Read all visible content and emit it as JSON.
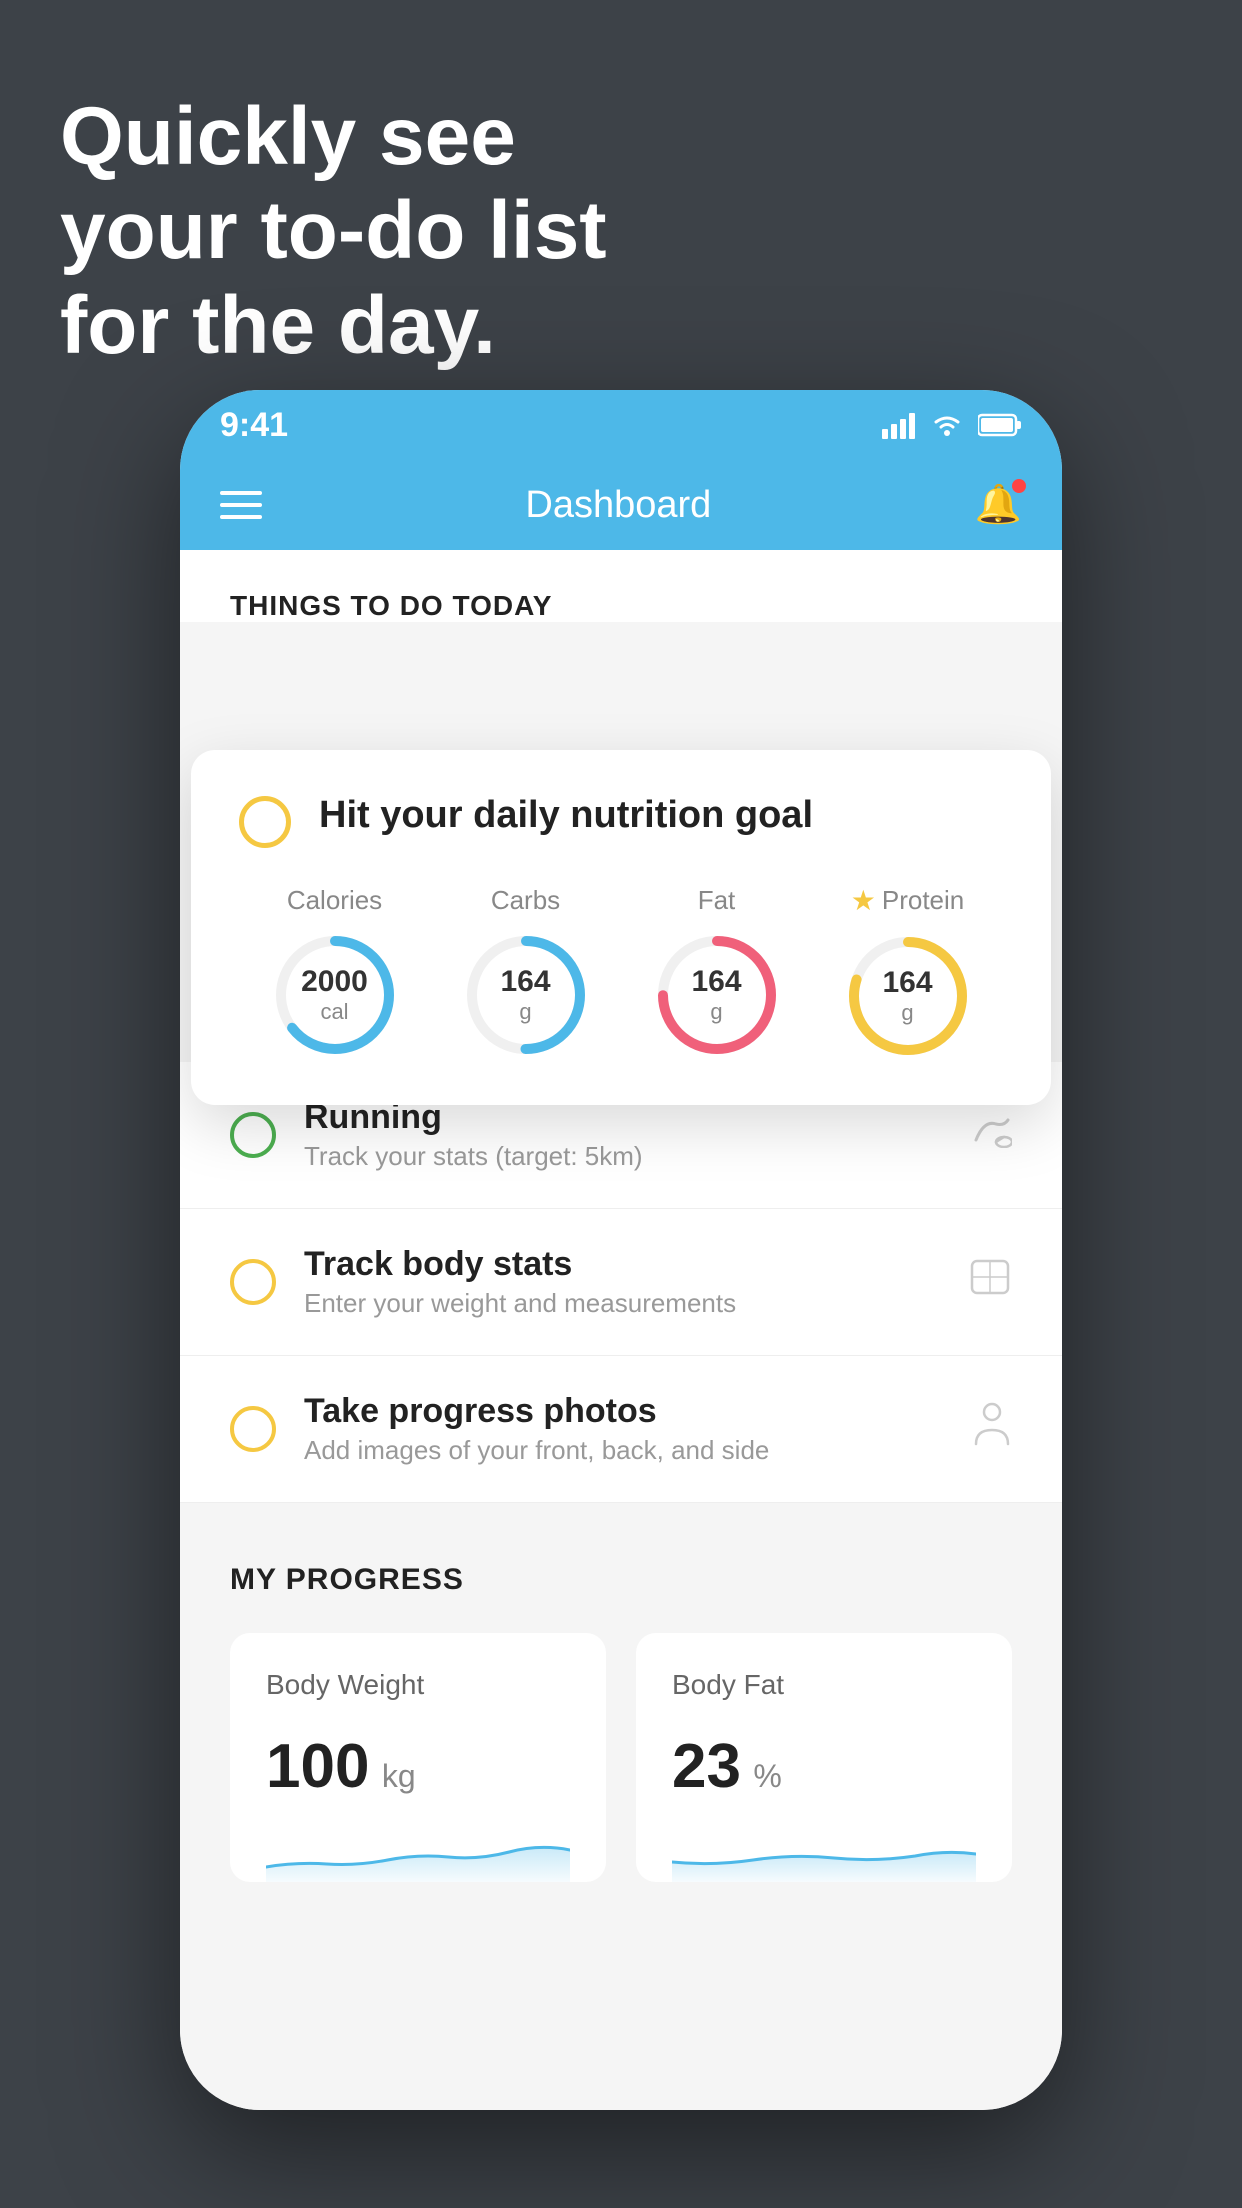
{
  "background": {
    "color": "#3d4248"
  },
  "headline": {
    "line1": "Quickly see",
    "line2": "your to-do list",
    "line3": "for the day."
  },
  "status_bar": {
    "time": "9:41",
    "signal": "▌▌▌▌",
    "wifi": "wifi",
    "battery": "battery"
  },
  "nav": {
    "title": "Dashboard"
  },
  "things_section": {
    "title": "THINGS TO DO TODAY"
  },
  "featured_todo": {
    "title": "Hit your daily nutrition goal",
    "indicator_color": "#f5c842"
  },
  "nutrition": {
    "items": [
      {
        "label": "Calories",
        "value": "2000",
        "unit": "cal",
        "ring_color": "blue",
        "percent": 0.65
      },
      {
        "label": "Carbs",
        "value": "164",
        "unit": "g",
        "ring_color": "blue",
        "percent": 0.5
      },
      {
        "label": "Fat",
        "value": "164",
        "unit": "g",
        "ring_color": "pink",
        "percent": 0.75
      },
      {
        "label": "Protein",
        "value": "164",
        "unit": "g",
        "ring_color": "yellow",
        "percent": 0.8,
        "starred": true
      }
    ]
  },
  "todo_items": [
    {
      "title": "Running",
      "subtitle": "Track your stats (target: 5km)",
      "indicator": "green",
      "icon": "shoe"
    },
    {
      "title": "Track body stats",
      "subtitle": "Enter your weight and measurements",
      "indicator": "yellow",
      "icon": "scale"
    },
    {
      "title": "Take progress photos",
      "subtitle": "Add images of your front, back, and side",
      "indicator": "yellow",
      "icon": "person"
    }
  ],
  "progress": {
    "title": "MY PROGRESS",
    "cards": [
      {
        "title": "Body Weight",
        "value": "100",
        "unit": "kg"
      },
      {
        "title": "Body Fat",
        "value": "23",
        "unit": "%"
      }
    ]
  }
}
